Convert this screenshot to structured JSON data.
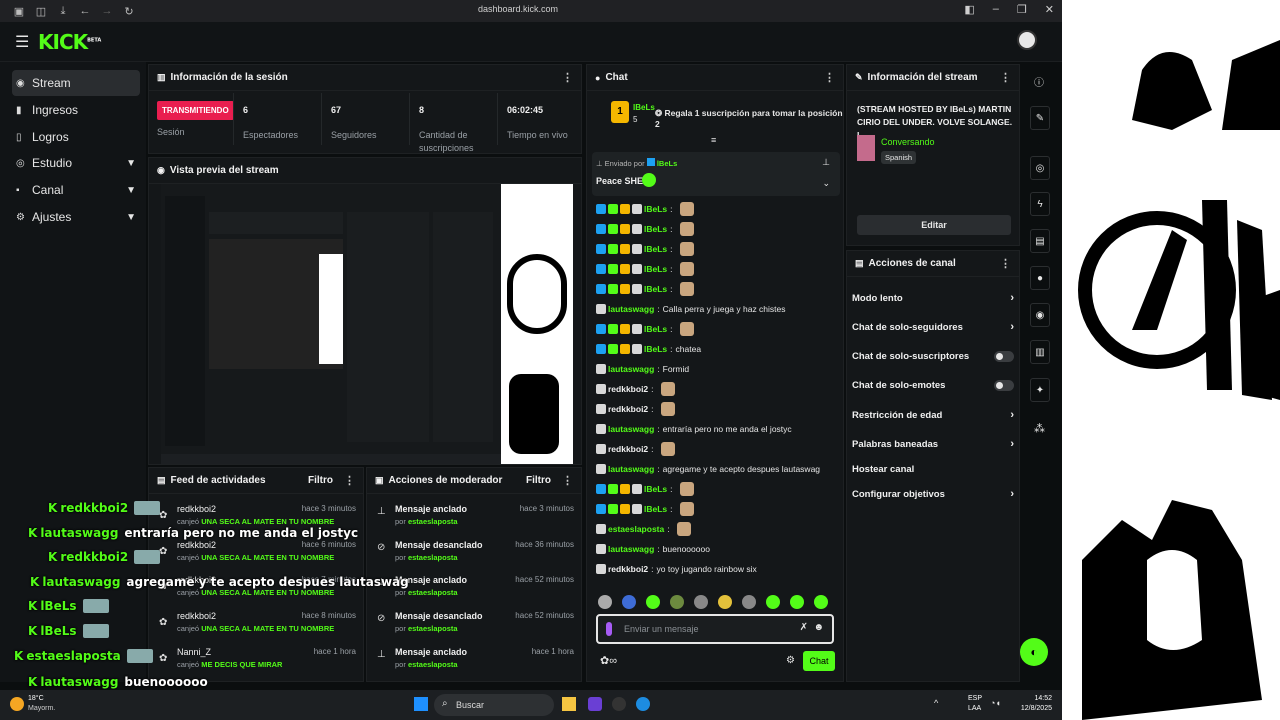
{
  "browser": {
    "url": "dashboard.kick.com"
  },
  "brand": {
    "logo": "KICK",
    "logo_sup": "BETA",
    "accent": "#53fc18"
  },
  "sidebar": {
    "items": [
      {
        "label": "Stream",
        "icon": "broadcast-icon"
      },
      {
        "label": "Ingresos",
        "icon": "revenue-icon"
      },
      {
        "label": "Logros",
        "icon": "trophy-icon"
      },
      {
        "label": "Estudio",
        "icon": "studio-icon"
      },
      {
        "label": "Canal",
        "icon": "channel-icon"
      },
      {
        "label": "Ajustes",
        "icon": "gear-icon"
      }
    ]
  },
  "session": {
    "title": "Información de la sesión",
    "status": "TRANSMITIENDO",
    "status_label": "Sesión",
    "viewers": "6",
    "viewers_label": "Espectadores",
    "followers": "67",
    "followers_label": "Seguidores",
    "subs": "8",
    "subs_label": "Cantidad de suscripciones",
    "uptime": "06:02:45",
    "uptime_label": "Tiempo en vivo"
  },
  "preview": {
    "title": "Vista previa del stream"
  },
  "feed": {
    "title": "Feed de actividades",
    "filter": "Filtro",
    "rows": [
      {
        "name": "redkkboi2",
        "time": "hace 3 minutos",
        "pre": "canjeó",
        "reward": "UNA SECA AL MATE EN TU NOMBRE"
      },
      {
        "name": "redkkboi2",
        "time": "hace 6 minutos",
        "pre": "canjeó",
        "reward": "UNA SECA AL MATE EN TU NOMBRE"
      },
      {
        "name": "redkkboi2",
        "time": "hace 7 minutos",
        "pre": "canjeó",
        "reward": "UNA SECA AL MATE EN TU NOMBRE"
      },
      {
        "name": "redkkboi2",
        "time": "hace 8 minutos",
        "pre": "canjeó",
        "reward": "UNA SECA AL MATE EN TU NOMBRE"
      },
      {
        "name": "Nanni_Z",
        "time": "hace 1 hora",
        "pre": "canjeó",
        "reward": "ME DECIS QUE MIRAR"
      }
    ]
  },
  "mod": {
    "title": "Acciones de moderador",
    "filter": "Filtro",
    "rows": [
      {
        "action": "Mensaje anclado",
        "time": "hace 3 minutos",
        "by": "por",
        "user": "estaeslaposta"
      },
      {
        "action": "Mensaje desanclado",
        "time": "hace 36 minutos",
        "by": "por",
        "user": "estaeslaposta"
      },
      {
        "action": "Mensaje anclado",
        "time": "hace 52 minutos",
        "by": "por",
        "user": "estaeslaposta"
      },
      {
        "action": "Mensaje desanclado",
        "time": "hace 52 minutos",
        "by": "por",
        "user": "estaeslaposta"
      },
      {
        "action": "Mensaje anclado",
        "time": "hace 1 hora",
        "by": "por",
        "user": "estaeslaposta"
      }
    ]
  },
  "chat": {
    "title": "Chat",
    "top_user": "lBeLs",
    "top_count": "5",
    "gift_text": "Regala 1 suscripción para tomar la posición 2",
    "pinned_by": "Enviado por",
    "pinned_user": "lBeLs",
    "pinned_msg": "Peace SHE",
    "messages": [
      {
        "user": "lBeLs",
        "text": "",
        "badges": true
      },
      {
        "user": "lBeLs",
        "text": "",
        "badges": true
      },
      {
        "user": "lBeLs",
        "text": "",
        "badges": true
      },
      {
        "user": "lBeLs",
        "text": "",
        "badges": true
      },
      {
        "user": "lBeLs",
        "text": "",
        "badges": true
      },
      {
        "user": "lautaswagg",
        "text": "Calla perra y juega y haz chistes",
        "badges": false
      },
      {
        "user": "lBeLs",
        "text": "",
        "badges": true
      },
      {
        "user": "lBeLs",
        "text": "chatea",
        "badges": true
      },
      {
        "user": "lautaswagg",
        "text": "Formid",
        "badges": false
      },
      {
        "user": "redkkboi2",
        "text": "",
        "badges": false
      },
      {
        "user": "redkkboi2",
        "text": "",
        "badges": false
      },
      {
        "user": "lautaswagg",
        "text": "entraría pero no me anda el jostyc",
        "badges": false
      },
      {
        "user": "redkkboi2",
        "text": "",
        "badges": false
      },
      {
        "user": "lautaswagg",
        "text": "agregame y te acepto despues lautaswag",
        "badges": false
      },
      {
        "user": "lBeLs",
        "text": "",
        "badges": true
      },
      {
        "user": "lBeLs",
        "text": "",
        "badges": true
      },
      {
        "user": "estaeslaposta",
        "text": "",
        "badges": false
      },
      {
        "user": "lautaswagg",
        "text": "buenoooooo",
        "badges": false
      },
      {
        "user": "redkkboi2",
        "text": "yo toy jugando rainbow six",
        "badges": false
      }
    ],
    "input_placeholder": "Enviar un mensaje",
    "send_label": "Chat"
  },
  "stream_info": {
    "title": "Información del stream",
    "stream_title": "(STREAM HOSTED BY lBeLs) MARTIN CIRIO DEL UNDER. VOLVE SOLANGE. L...",
    "category": "Conversando",
    "language": "Spanish",
    "edit": "Editar"
  },
  "channel_actions": {
    "title": "Acciones de canal",
    "items": [
      {
        "label": "Modo lento",
        "kind": "chevron"
      },
      {
        "label": "Chat de solo-seguidores",
        "kind": "chevron"
      },
      {
        "label": "Chat de solo-suscriptores",
        "kind": "toggle"
      },
      {
        "label": "Chat de solo-emotes",
        "kind": "toggle"
      },
      {
        "label": "Restricción de edad",
        "kind": "chevron"
      },
      {
        "label": "Palabras baneadas",
        "kind": "chevron"
      },
      {
        "label": "Hostear canal",
        "kind": "none"
      },
      {
        "label": "Configurar objetivos",
        "kind": "chevron"
      }
    ]
  },
  "overlay": {
    "lines": [
      {
        "user": "redkkboi2",
        "text": ""
      },
      {
        "user": "lautaswagg",
        "text": "entraría pero no me anda el jostyc"
      },
      {
        "user": "redkkboi2",
        "text": ""
      },
      {
        "user": "lautaswagg",
        "text": "agregame y te acepto despues lautaswag"
      },
      {
        "user": "lBeLs",
        "text": ""
      },
      {
        "user": "lBeLs",
        "text": ""
      },
      {
        "user": "estaeslaposta",
        "text": ""
      },
      {
        "user": "lautaswagg",
        "text": "buenoooooo"
      },
      {
        "user": "redkkboi2",
        "text": "yo toy jugando rainbow six"
      }
    ]
  },
  "taskbar": {
    "weather_temp": "18°C",
    "weather_desc": "Mayorm.",
    "search": "Buscar",
    "lang": "ESP",
    "lang2": "LAA",
    "time": "14:52",
    "date": "12/8/2025"
  }
}
